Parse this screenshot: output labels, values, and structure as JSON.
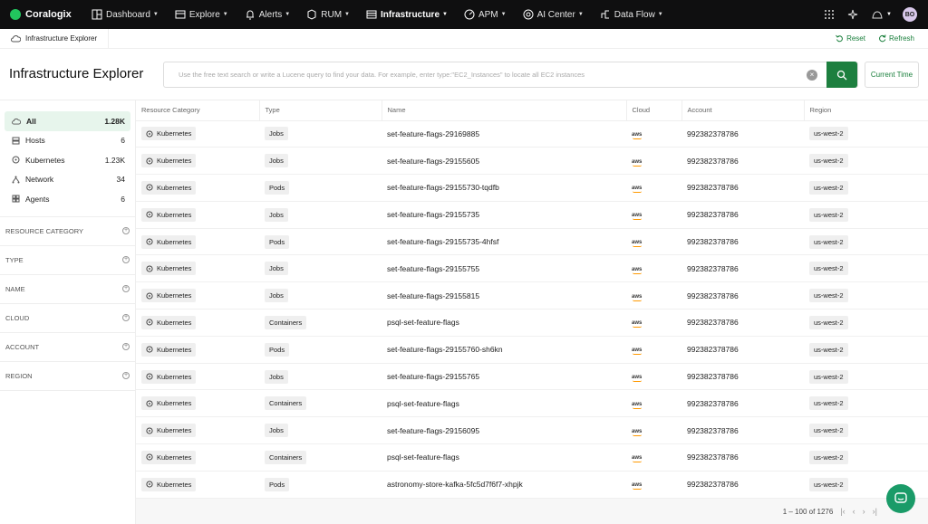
{
  "nav": {
    "logo": "Coralogix",
    "items": [
      {
        "label": "Dashboard",
        "icon": "dashboard-icon"
      },
      {
        "label": "Explore",
        "icon": "explore-icon"
      },
      {
        "label": "Alerts",
        "icon": "bell-icon"
      },
      {
        "label": "RUM",
        "icon": "rum-icon"
      },
      {
        "label": "Infrastructure",
        "icon": "infrastructure-icon",
        "active": true
      },
      {
        "label": "APM",
        "icon": "gauge-icon"
      },
      {
        "label": "AI Center",
        "icon": "ai-icon"
      },
      {
        "label": "Data Flow",
        "icon": "data-flow-icon"
      }
    ],
    "avatar": "BO"
  },
  "breadcrumb": {
    "label": "Infrastructure Explorer"
  },
  "actions": {
    "reset": "Reset",
    "refresh": "Refresh"
  },
  "page": {
    "title": "Infrastructure Explorer"
  },
  "search": {
    "placeholder": "Use the free text search or write a Lucene query to find your data. For example, enter type:\"EC2_Instances\" to locate all EC2 instances",
    "time_button": "Current Time"
  },
  "sidebar": {
    "resources": [
      {
        "label": "All",
        "count": "1.28K",
        "icon": "cloud-icon"
      },
      {
        "label": "Hosts",
        "count": "6",
        "icon": "host-icon"
      },
      {
        "label": "Kubernetes",
        "count": "1.23K",
        "icon": "kubernetes-icon"
      },
      {
        "label": "Network",
        "count": "34",
        "icon": "network-icon"
      },
      {
        "label": "Agents",
        "count": "6",
        "icon": "agents-icon"
      }
    ],
    "filters": [
      "RESOURCE CATEGORY",
      "TYPE",
      "NAME",
      "CLOUD",
      "ACCOUNT",
      "REGION"
    ]
  },
  "table": {
    "columns": [
      "Resource Category",
      "Type",
      "Name",
      "Cloud",
      "Account",
      "Region"
    ],
    "cloud_text": "aws",
    "rows": [
      {
        "category": "Kubernetes",
        "type": "Jobs",
        "name": "set-feature-flags-29169885",
        "account": "992382378786",
        "region": "us-west-2"
      },
      {
        "category": "Kubernetes",
        "type": "Jobs",
        "name": "set-feature-flags-29155605",
        "account": "992382378786",
        "region": "us-west-2"
      },
      {
        "category": "Kubernetes",
        "type": "Pods",
        "name": "set-feature-flags-29155730-tqdfb",
        "account": "992382378786",
        "region": "us-west-2"
      },
      {
        "category": "Kubernetes",
        "type": "Jobs",
        "name": "set-feature-flags-29155735",
        "account": "992382378786",
        "region": "us-west-2"
      },
      {
        "category": "Kubernetes",
        "type": "Pods",
        "name": "set-feature-flags-29155735-4hfsf",
        "account": "992382378786",
        "region": "us-west-2"
      },
      {
        "category": "Kubernetes",
        "type": "Jobs",
        "name": "set-feature-flags-29155755",
        "account": "992382378786",
        "region": "us-west-2"
      },
      {
        "category": "Kubernetes",
        "type": "Jobs",
        "name": "set-feature-flags-29155815",
        "account": "992382378786",
        "region": "us-west-2"
      },
      {
        "category": "Kubernetes",
        "type": "Containers",
        "name": "psql-set-feature-flags",
        "account": "992382378786",
        "region": "us-west-2"
      },
      {
        "category": "Kubernetes",
        "type": "Pods",
        "name": "set-feature-flags-29155760-sh6kn",
        "account": "992382378786",
        "region": "us-west-2"
      },
      {
        "category": "Kubernetes",
        "type": "Jobs",
        "name": "set-feature-flags-29155765",
        "account": "992382378786",
        "region": "us-west-2"
      },
      {
        "category": "Kubernetes",
        "type": "Containers",
        "name": "psql-set-feature-flags",
        "account": "992382378786",
        "region": "us-west-2"
      },
      {
        "category": "Kubernetes",
        "type": "Jobs",
        "name": "set-feature-flags-29156095",
        "account": "992382378786",
        "region": "us-west-2"
      },
      {
        "category": "Kubernetes",
        "type": "Containers",
        "name": "psql-set-feature-flags",
        "account": "992382378786",
        "region": "us-west-2"
      },
      {
        "category": "Kubernetes",
        "type": "Pods",
        "name": "astronomy-store-kafka-5fc5d7f6f7-xhpjk",
        "account": "992382378786",
        "region": "us-west-2"
      }
    ]
  },
  "pagination": {
    "range": "1 – 100 of 1276"
  },
  "colors": {
    "accent": "#1d7f3f",
    "nav_bg": "#0f0f10",
    "logo_dot": "#22c55e"
  }
}
